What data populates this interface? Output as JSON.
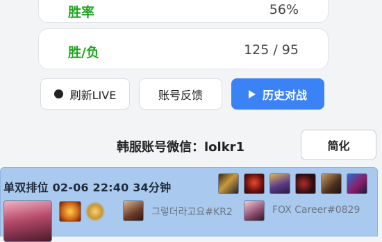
{
  "stats": {
    "winrate_label": "胜率",
    "winrate_value": "56%",
    "winloss_label": "胜/负",
    "winloss_value": "125 / 95"
  },
  "actions": {
    "refresh_live": "刷新LIVE",
    "feedback": "账号反馈",
    "history": "历史对战"
  },
  "contact": {
    "text": "韩服账号微信：lolkr1"
  },
  "simplify_label": "简化",
  "match": {
    "header": "单双排位  02-06 22:40  34分钟",
    "players": [
      "그렇더라고요#KR2",
      "FOX Career#0829"
    ]
  },
  "colors": {
    "accent": "#3b82f6",
    "win_green": "#1fa51f",
    "match_bg": "#a9c9ee"
  },
  "icons": [
    "record-icon",
    "play-icon",
    "item-icon",
    "champion-icon",
    "rune-icon"
  ]
}
